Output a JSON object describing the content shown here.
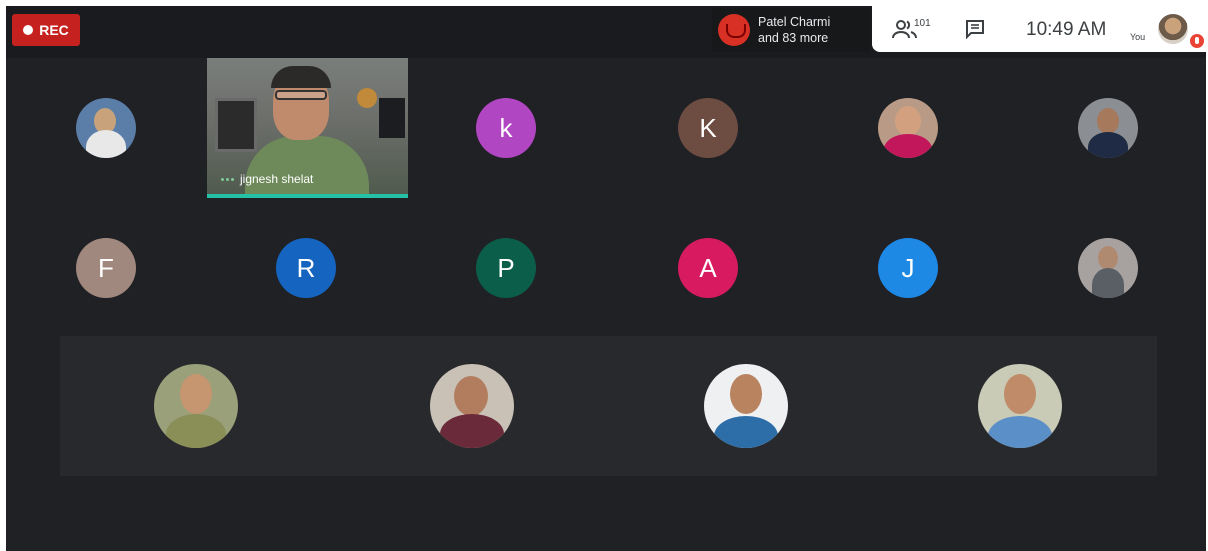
{
  "topbar": {
    "rec_label": "REC",
    "presence": {
      "line1": "Patel Charmi",
      "line2": "and 83 more"
    },
    "people_count": "101",
    "clock": "10:49 AM",
    "self_label": "You"
  },
  "video_tile": {
    "name": "jignesh shelat"
  },
  "tiles": {
    "k_lower": "k",
    "K_upper": "K",
    "F": "F",
    "R": "R",
    "P": "P",
    "A": "A",
    "J": "J"
  },
  "colors": {
    "rec": "#c5221f",
    "k_lower": "#b146c2",
    "K_upper": "#6d4c41",
    "F": "#a1887f",
    "R": "#1565c0",
    "P": "#0b5e4a",
    "A": "#d81b60",
    "J": "#1e88e5",
    "speaking": "#24c1a7"
  }
}
